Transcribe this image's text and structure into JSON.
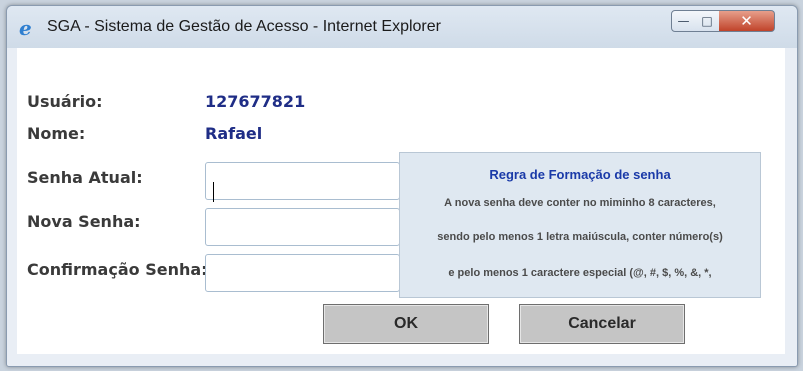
{
  "window": {
    "title": "SGA - Sistema de Gestão de Acesso - Internet Explorer",
    "icon": "internet-explorer-icon",
    "controls": {
      "minimize": "—",
      "maximize": "□",
      "close": "✕"
    }
  },
  "form": {
    "usuario_label": "Usuário:",
    "usuario_value": "127677821",
    "nome_label": "Nome:",
    "nome_value": "Rafael",
    "senha_atual_label": "Senha Atual:",
    "senha_atual_value": "",
    "nova_senha_label": "Nova Senha:",
    "nova_senha_value": "",
    "confirmacao_label": "Confirmação Senha:",
    "confirmacao_value": ""
  },
  "tooltip": {
    "title": "Regra de Formação de senha",
    "lines": [
      "A nova senha deve conter no miminho 8 caracteres,",
      "sendo pelo menos 1 letra maiúscula, conter número(s)",
      "e pelo menos 1 caractere especial (@, #, $, %, &, *,"
    ]
  },
  "buttons": {
    "ok": "OK",
    "cancel": "Cancelar"
  },
  "colors": {
    "value_text": "#1f2d86",
    "tooltip_title": "#1a3aa8",
    "tooltip_bg": "#dfe8f1"
  }
}
